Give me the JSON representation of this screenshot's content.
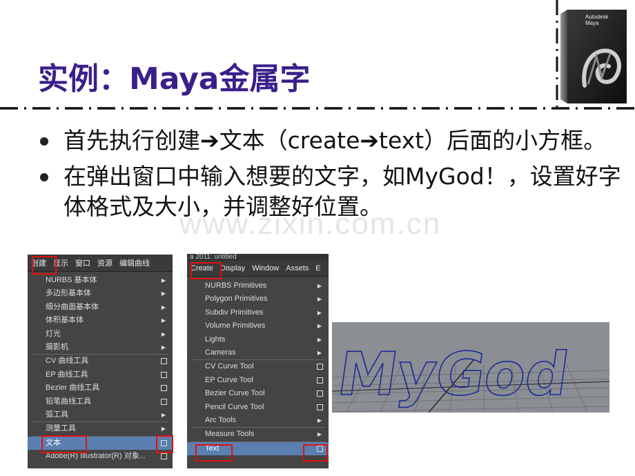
{
  "title": "实例：Maya金属字",
  "product_box": {
    "brand": "Autodesk",
    "product": "Maya"
  },
  "bullets": [
    "首先执行创建➔文本（create➔text）后面的小方框。",
    "在弹出窗口中输入想要的文字，如MyGod！，设置好字体格式及大小，并调整好位置。"
  ],
  "watermark": "www.zixin.com.cn",
  "menu_cn": {
    "bar": [
      "创建",
      "显示",
      "窗口",
      "资源",
      "编辑曲线"
    ],
    "groups": [
      [
        {
          "label": "NURBS 基本体",
          "kind": "arrow"
        },
        {
          "label": "多边形基本体",
          "kind": "arrow"
        },
        {
          "label": "细分曲面基本体",
          "kind": "arrow"
        },
        {
          "label": "体积基本体",
          "kind": "arrow"
        },
        {
          "label": "灯光",
          "kind": "arrow"
        },
        {
          "label": "摄影机",
          "kind": "arrow"
        }
      ],
      [
        {
          "label": "CV 曲线工具",
          "kind": "option"
        },
        {
          "label": "EP 曲线工具",
          "kind": "option"
        },
        {
          "label": "Bezier 曲线工具",
          "kind": "option"
        },
        {
          "label": "铅笔曲线工具",
          "kind": "option"
        },
        {
          "label": "弧工具",
          "kind": "arrow"
        }
      ],
      [
        {
          "label": "测量工具",
          "kind": "arrow"
        }
      ],
      [
        {
          "label": "文本",
          "kind": "option",
          "selected": true
        },
        {
          "label": "Adobe(R) Illustrator(R) 对象...",
          "kind": "option"
        }
      ]
    ]
  },
  "menu_en": {
    "window_title": "a 2011: untitled",
    "bar": [
      "Create",
      "Display",
      "Window",
      "Assets",
      "E"
    ],
    "groups": [
      [
        {
          "label": "NURBS Primitives",
          "kind": "arrow"
        },
        {
          "label": "Polygon Primitives",
          "kind": "arrow"
        },
        {
          "label": "Subdiv Primitives",
          "kind": "arrow"
        },
        {
          "label": "Volume Primitives",
          "kind": "arrow"
        },
        {
          "label": "Lights",
          "kind": "arrow"
        },
        {
          "label": "Cameras",
          "kind": "arrow"
        }
      ],
      [
        {
          "label": "CV Curve Tool",
          "kind": "option"
        },
        {
          "label": "EP Curve Tool",
          "kind": "option"
        },
        {
          "label": "Bezier Curve Tool",
          "kind": "option"
        },
        {
          "label": "Pencil Curve Tool",
          "kind": "option"
        },
        {
          "label": "Arc Tools",
          "kind": "arrow"
        }
      ],
      [
        {
          "label": "Measure Tools",
          "kind": "arrow"
        }
      ],
      [
        {
          "label": "Text",
          "kind": "option",
          "selected": true
        }
      ]
    ]
  },
  "viewport_text": "MyGod"
}
